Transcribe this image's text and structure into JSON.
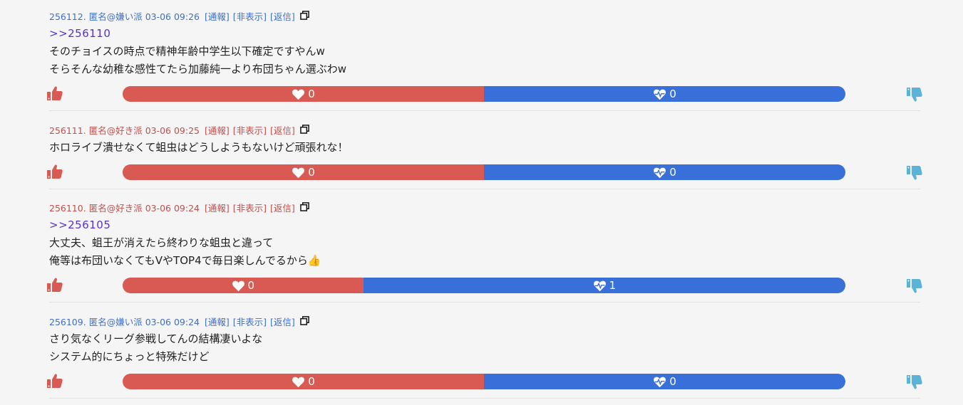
{
  "posts": [
    {
      "id": "256112.",
      "author": "匿名@嫌い派",
      "faction": "kirai",
      "date": "03-06 09:26",
      "report": "[通報]",
      "hide": "[非表示]",
      "reply": "[返信]",
      "anchor": ">>256110",
      "lines": [
        "そのチョイスの時点で精神年齢中学生以下確定ですやんw",
        "そらそんな幼稚な感性てたら加藤純一より布団ちゃん選ぶわw"
      ],
      "likes": "0",
      "dislikes": "0",
      "like_ratio": 0.5
    },
    {
      "id": "256111.",
      "author": "匿名@好き派",
      "faction": "suki",
      "date": "03-06 09:25",
      "report": "[通報]",
      "hide": "[非表示]",
      "reply": "[返信]",
      "anchor": "",
      "lines": [
        "ホロライブ潰せなくて蛆虫はどうしようもないけど頑張れな！"
      ],
      "likes": "0",
      "dislikes": "0",
      "like_ratio": 0.5
    },
    {
      "id": "256110.",
      "author": "匿名@好き派",
      "faction": "suki",
      "date": "03-06 09:24",
      "report": "[通報]",
      "hide": "[非表示]",
      "reply": "[返信]",
      "anchor": ">>256105",
      "lines": [
        "大丈夫、蛆王が消えたら終わりな蛆虫と違って",
        "俺等は布団いなくてもVやTOP4で毎日楽しんでるから👍"
      ],
      "likes": "0",
      "dislikes": "1",
      "like_ratio": 0.333
    },
    {
      "id": "256109.",
      "author": "匿名@嫌い派",
      "faction": "kirai",
      "date": "03-06 09:24",
      "report": "[通報]",
      "hide": "[非表示]",
      "reply": "[返信]",
      "anchor": "",
      "lines": [
        "さり気なくリーグ参戦してんの結構凄いよな",
        "システム的にちょっと特殊だけど"
      ],
      "likes": "0",
      "dislikes": "0",
      "like_ratio": 0.5
    }
  ],
  "colors": {
    "like": "#d85a52",
    "dislike": "#386fd8",
    "kirai": "#3f6fc9",
    "suki": "#c0504d",
    "anchor": "#5a2fd8",
    "thumb_up": "#d85a52",
    "thumb_down": "#5bb3d8"
  },
  "icons": {
    "thumb_up": "thumbs-up-icon",
    "thumb_down": "thumbs-down-icon",
    "like": "heart-icon",
    "dislike": "heart-pulse-icon",
    "copy": "copy-icon"
  }
}
